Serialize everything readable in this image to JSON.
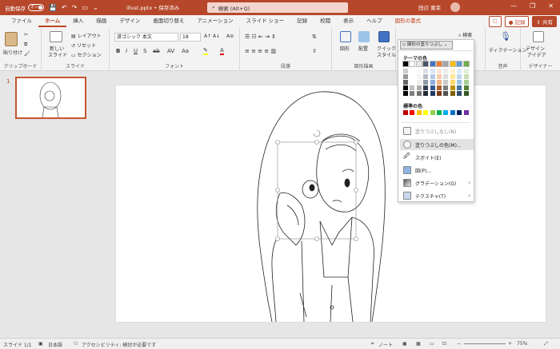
{
  "titlebar": {
    "autosave_label": "自動保存",
    "autosave_state": "オン",
    "filename": "illust.pptx • 保存済み",
    "search_placeholder": "検索 (Alt+Q)",
    "user_name": "田辺 寛幸",
    "minimize": "—",
    "restore": "❐",
    "close": "✕"
  },
  "tabs": [
    "ファイル",
    "ホーム",
    "挿入",
    "描画",
    "デザイン",
    "画面切り替え",
    "アニメーション",
    "スライド ショー",
    "記録",
    "校閲",
    "表示",
    "ヘルプ",
    "図形の書式"
  ],
  "tab_actions": {
    "record": "記録",
    "share": "共有"
  },
  "ribbon": {
    "clipboard": {
      "paste": "貼り付け",
      "label": "クリップボード"
    },
    "slides": {
      "new_slide": "新しい",
      "new_slide2": "スライド",
      "layout": "レイアウト",
      "reset": "リセット",
      "section": "セクション",
      "label": "スライド"
    },
    "font": {
      "font_name": "游ゴシック 本文",
      "font_size": "18",
      "label": "フォント"
    },
    "paragraph": {
      "label": "段落"
    },
    "drawing": {
      "shape": "図形",
      "arrange": "配置",
      "quick_style": "クイック",
      "quick_style2": "スタイル",
      "label": "図形描画"
    },
    "editing": {
      "search": "検索"
    },
    "voice": {
      "dictate": "ディクテーション",
      "label": "音声"
    },
    "designer": {
      "designer": "デザイン",
      "designer2": "アイデア",
      "label": "デザイナー"
    }
  },
  "thumbnail": {
    "number": "1"
  },
  "dropdown": {
    "header": "図形の塗りつぶし",
    "theme_colors_title": "テーマの色",
    "standard_colors_title": "標準の色",
    "items": [
      {
        "label": "塗りつぶしなし(N)",
        "icon": "no-fill-icon"
      },
      {
        "label": "塗りつぶしの色(M)...",
        "icon": "fill-color-icon"
      },
      {
        "label": "スポイト(E)",
        "icon": "eyedropper-icon"
      },
      {
        "label": "図(P)...",
        "icon": "picture-icon"
      },
      {
        "label": "グラデーション(G)",
        "icon": "gradient-icon"
      },
      {
        "label": "テクスチャ(T)",
        "icon": "texture-icon"
      }
    ],
    "theme_top_row": [
      "#000000",
      "#ffffff",
      "#e7e6e6",
      "#44546a",
      "#4472c4",
      "#ed7d31",
      "#a5a5a5",
      "#ffc000",
      "#5b9bd5",
      "#70ad47"
    ],
    "standard_colors": [
      "#c00000",
      "#ff0000",
      "#ffc000",
      "#ffff00",
      "#92d050",
      "#00b050",
      "#00b0f0",
      "#0070c0",
      "#002060",
      "#7030a0"
    ]
  },
  "statusbar": {
    "slide": "スライド 1/1",
    "language": "日本語",
    "accessibility": "アクセシビリティ: 検討が必要です",
    "notes": "ノート",
    "zoom": "75%"
  },
  "colors": {
    "accent": "#b7472a",
    "selection": "#c4562f"
  }
}
